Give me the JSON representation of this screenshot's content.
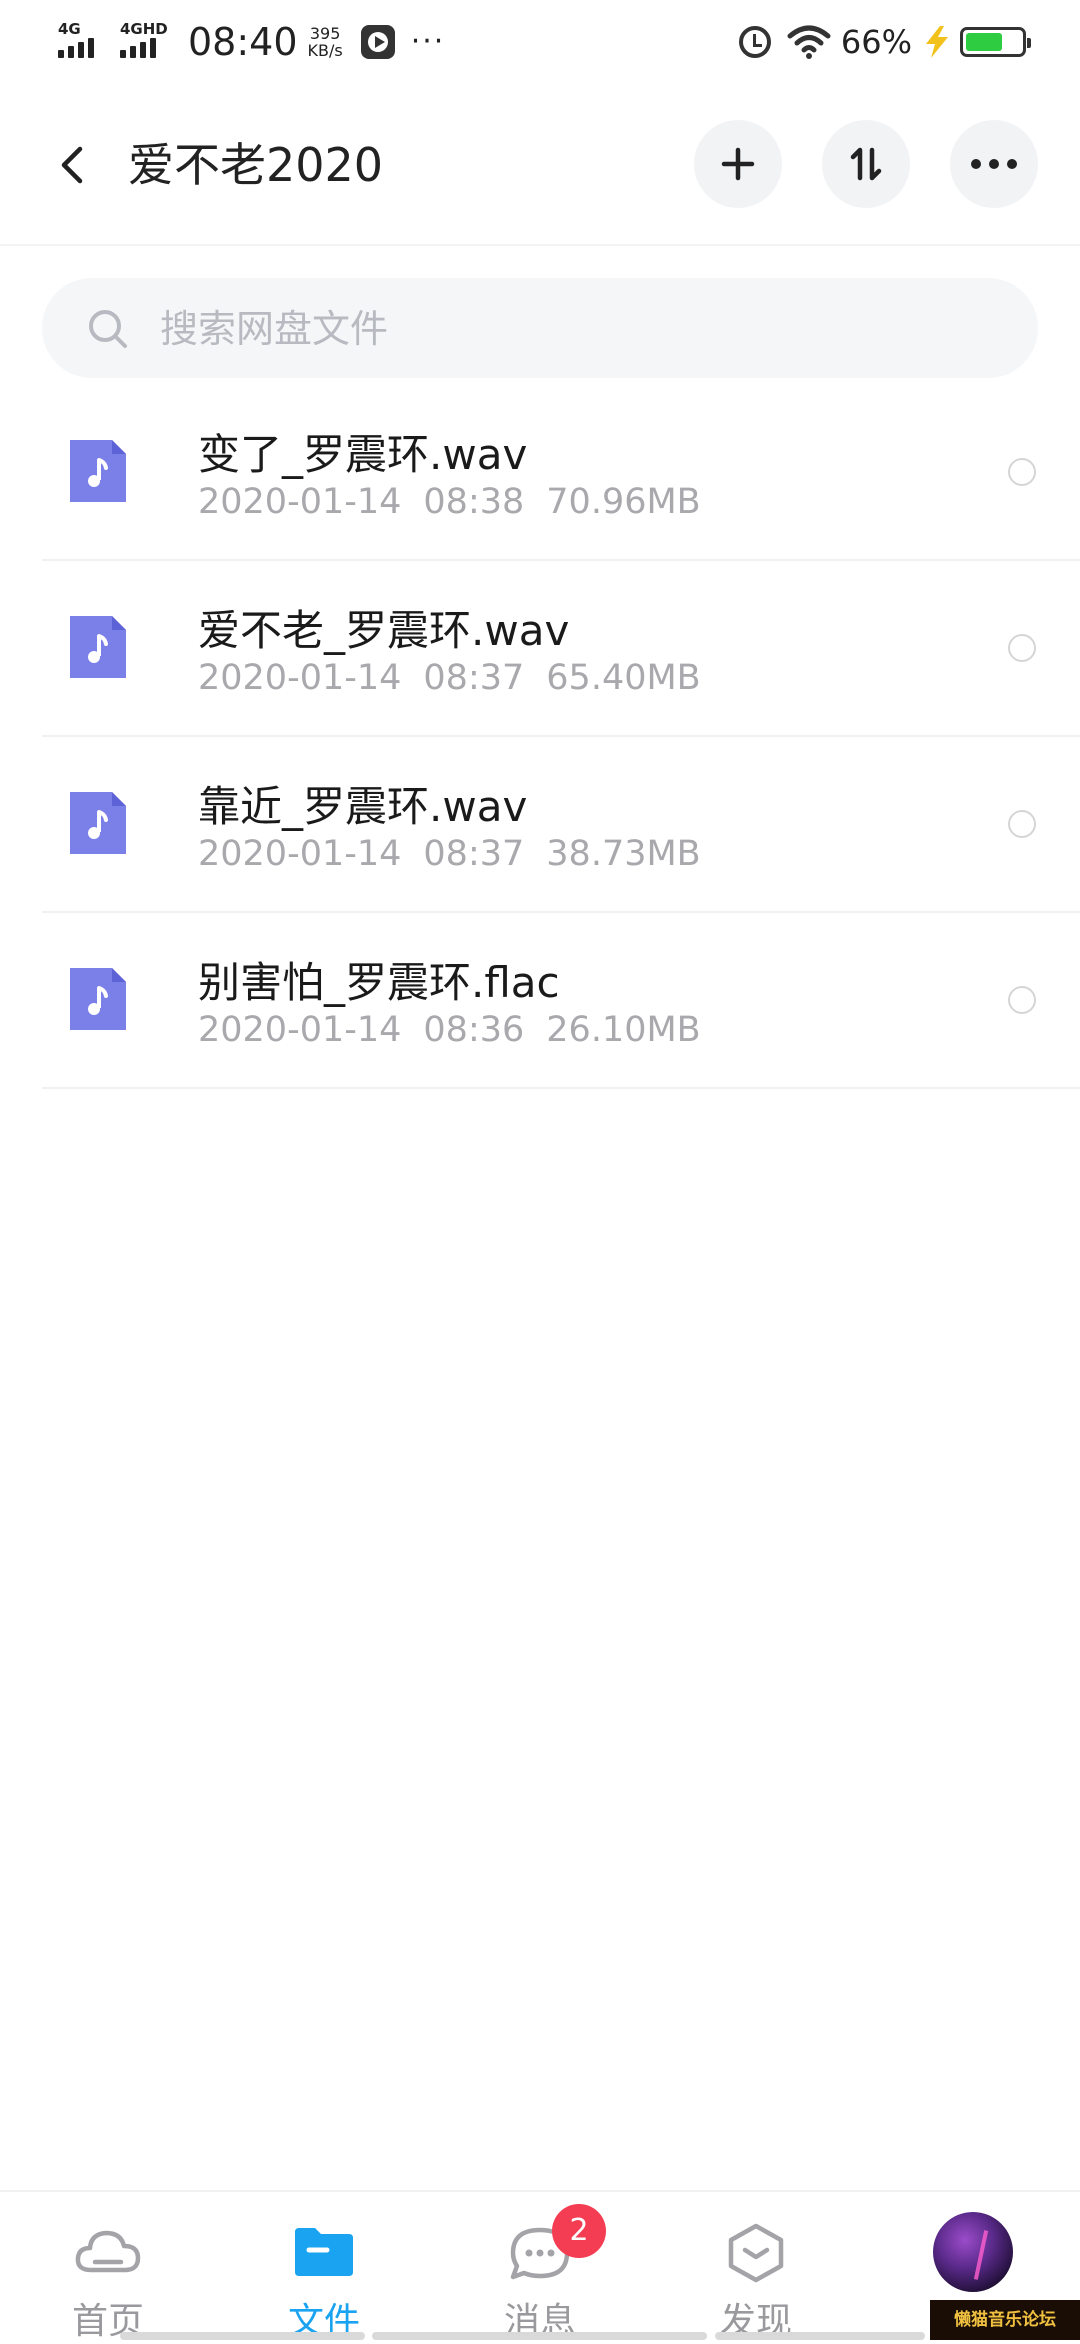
{
  "status_bar": {
    "network_1": "4G",
    "network_2": "4GHD",
    "time": "08:40",
    "speed_value": "395",
    "speed_unit": "KB/s",
    "more": "···",
    "battery_percent": "66%",
    "battery_level": 0.66,
    "battery_color": "#2ecc40"
  },
  "header": {
    "title": "爱不老2020",
    "add_icon": "plus-icon",
    "sort_icon": "sort-icon",
    "more_icon": "more-icon"
  },
  "search": {
    "placeholder": "搜索网盘文件"
  },
  "files": [
    {
      "name": "变了_罗震环.wav",
      "date": "2020-01-14",
      "time": "08:38",
      "size": "70.96MB"
    },
    {
      "name": "爱不老_罗震环.wav",
      "date": "2020-01-14",
      "time": "08:37",
      "size": "65.40MB"
    },
    {
      "name": "靠近_罗震环.wav",
      "date": "2020-01-14",
      "time": "08:37",
      "size": "38.73MB"
    },
    {
      "name": "别害怕_罗震环.flac",
      "date": "2020-01-14",
      "time": "08:36",
      "size": "26.10MB"
    }
  ],
  "bottom_nav": {
    "items": [
      {
        "label": "首页",
        "icon": "cloud-icon"
      },
      {
        "label": "文件",
        "icon": "folder-icon",
        "active": true
      },
      {
        "label": "消息",
        "icon": "chat-icon",
        "badge": "2"
      },
      {
        "label": "发现",
        "icon": "discover-icon"
      }
    ]
  },
  "watermark": "懒猫音乐论坛",
  "colors": {
    "accent": "#1aa3f0",
    "file_icon": "#7b7fe8",
    "badge": "#f43d52"
  }
}
